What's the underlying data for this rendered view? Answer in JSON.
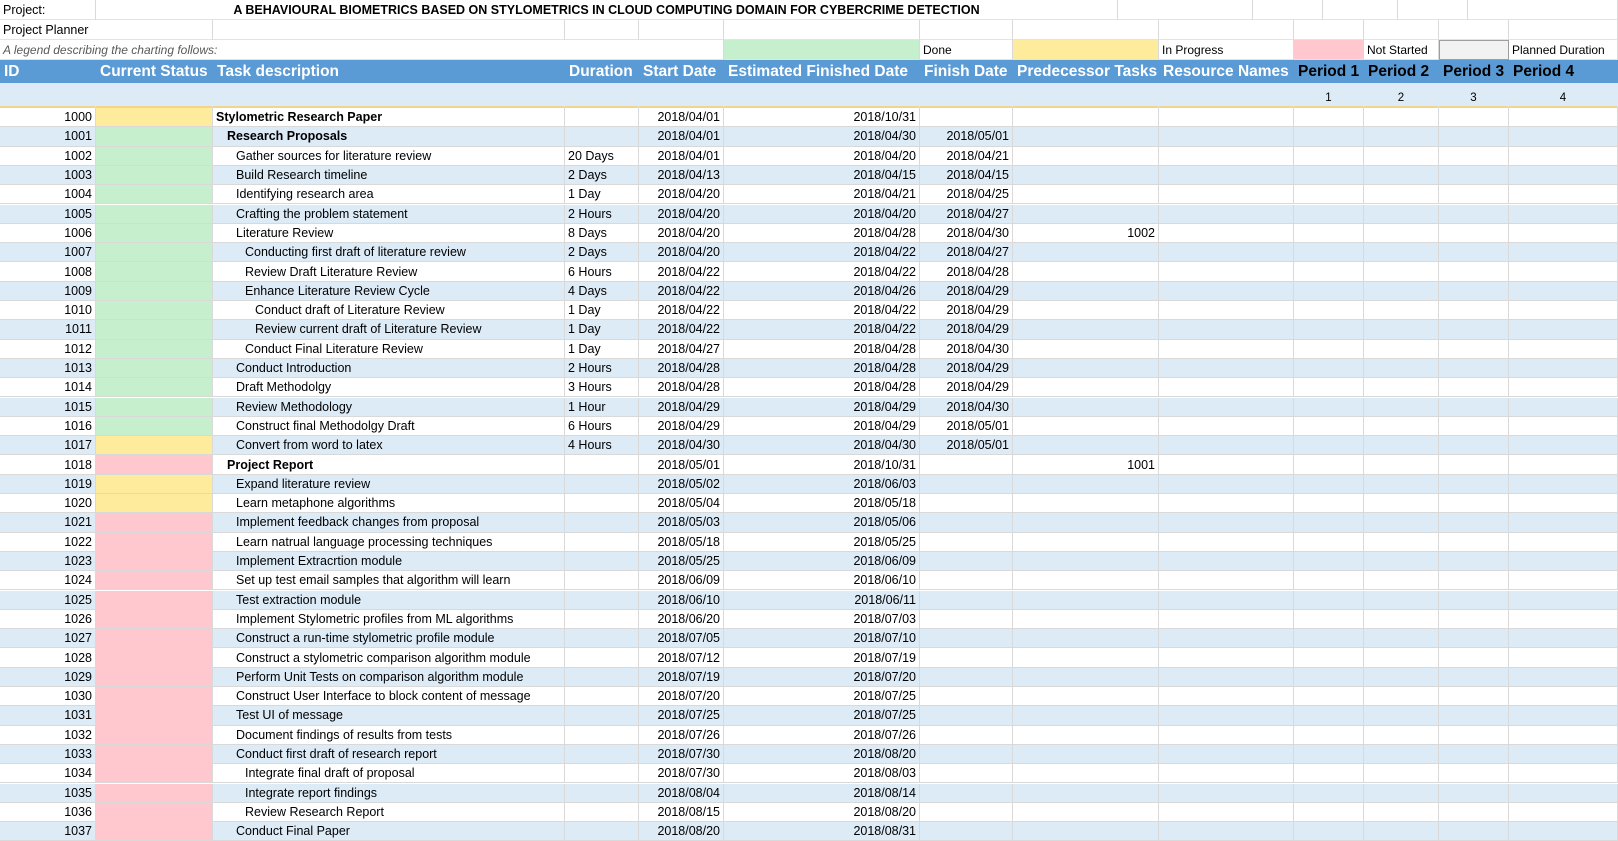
{
  "project_label": "Project:",
  "project_title": "A BEHAVIOURAL BIOMETRICS BASED ON STYLOMETRICS IN CLOUD COMPUTING DOMAIN FOR CYBERCRIME DETECTION",
  "planner_label": "Project Planner",
  "legend": {
    "text": "A legend describing the charting follows:",
    "done": "Done",
    "in_progress": "In Progress",
    "not_started": "Not Started",
    "planned": "Planned Duration"
  },
  "headers": {
    "id": "ID",
    "status": "Current Status",
    "task": "Task description",
    "duration": "Duration",
    "start": "Start Date",
    "est_finish": "Estimated Finished Date",
    "finish": "Finish Date",
    "predecessor": "Predecessor Tasks",
    "resource": "Resource Names",
    "p1": "Period 1",
    "p2": "Period 2",
    "p3": "Period 3",
    "p4": "Period 4"
  },
  "period_numbers": [
    "1",
    "2",
    "3",
    "4"
  ],
  "status_colors": {
    "done": "#c6efce",
    "in_progress": "#ffeb9c",
    "not_started": "#ffc7ce"
  },
  "rows": [
    {
      "id": "1000",
      "status": "in_progress",
      "level": 0,
      "task": "Stylometric Research Paper",
      "duration": "",
      "start": "2018/04/01",
      "est": "2018/10/31",
      "finish": "",
      "pred": ""
    },
    {
      "id": "1001",
      "status": "done",
      "level": 1,
      "task": "Research Proposals",
      "duration": "",
      "start": "2018/04/01",
      "est": "2018/04/30",
      "finish": "2018/05/01",
      "pred": ""
    },
    {
      "id": "1002",
      "status": "done",
      "level": 2,
      "task": "Gather sources for literature review",
      "duration": "20 Days",
      "start": "2018/04/01",
      "est": "2018/04/20",
      "finish": "2018/04/21",
      "pred": ""
    },
    {
      "id": "1003",
      "status": "done",
      "level": 2,
      "task": "Build Research timeline",
      "duration": "2 Days",
      "start": "2018/04/13",
      "est": "2018/04/15",
      "finish": "2018/04/15",
      "pred": ""
    },
    {
      "id": "1004",
      "status": "done",
      "level": 2,
      "task": "Identifying research area",
      "duration": "1 Day",
      "start": "2018/04/20",
      "est": "2018/04/21",
      "finish": "2018/04/25",
      "pred": ""
    },
    {
      "id": "1005",
      "status": "done",
      "level": 2,
      "task": "Crafting the problem statement",
      "duration": "2 Hours",
      "start": "2018/04/20",
      "est": "2018/04/20",
      "finish": "2018/04/27",
      "pred": ""
    },
    {
      "id": "1006",
      "status": "done",
      "level": 2,
      "task": "Literature Review",
      "duration": "8 Days",
      "start": "2018/04/20",
      "est": "2018/04/28",
      "finish": "2018/04/30",
      "pred": "1002"
    },
    {
      "id": "1007",
      "status": "done",
      "level": 3,
      "task": "Conducting first draft of literature review",
      "duration": "2 Days",
      "start": "2018/04/20",
      "est": "2018/04/22",
      "finish": "2018/04/27",
      "pred": ""
    },
    {
      "id": "1008",
      "status": "done",
      "level": 3,
      "task": "Review Draft Literature Review",
      "duration": "6 Hours",
      "start": "2018/04/22",
      "est": "2018/04/22",
      "finish": "2018/04/28",
      "pred": ""
    },
    {
      "id": "1009",
      "status": "done",
      "level": 3,
      "task": "Enhance Literature Review Cycle",
      "duration": "4 Days",
      "start": "2018/04/22",
      "est": "2018/04/26",
      "finish": "2018/04/29",
      "pred": ""
    },
    {
      "id": "1010",
      "status": "done",
      "level": 4,
      "task": "Conduct draft of Literature Review",
      "duration": "1 Day",
      "start": "2018/04/22",
      "est": "2018/04/22",
      "finish": "2018/04/29",
      "pred": ""
    },
    {
      "id": "1011",
      "status": "done",
      "level": 4,
      "task": "Review current draft of Literature Review",
      "duration": "1 Day",
      "start": "2018/04/22",
      "est": "2018/04/22",
      "finish": "2018/04/29",
      "pred": ""
    },
    {
      "id": "1012",
      "status": "done",
      "level": 3,
      "task": "Conduct Final Literature Review",
      "duration": "1 Day",
      "start": "2018/04/27",
      "est": "2018/04/28",
      "finish": "2018/04/30",
      "pred": ""
    },
    {
      "id": "1013",
      "status": "done",
      "level": 2,
      "task": "Conduct Introduction",
      "duration": "2 Hours",
      "start": "2018/04/28",
      "est": "2018/04/28",
      "finish": "2018/04/29",
      "pred": ""
    },
    {
      "id": "1014",
      "status": "done",
      "level": 2,
      "task": "Draft Methodolgy",
      "duration": "3 Hours",
      "start": "2018/04/28",
      "est": "2018/04/28",
      "finish": "2018/04/29",
      "pred": ""
    },
    {
      "id": "1015",
      "status": "done",
      "level": 2,
      "task": "Review Methodology",
      "duration": "1 Hour",
      "start": "2018/04/29",
      "est": "2018/04/29",
      "finish": "2018/04/30",
      "pred": ""
    },
    {
      "id": "1016",
      "status": "done",
      "level": 2,
      "task": "Construct final Methodolgy Draft",
      "duration": "6 Hours",
      "start": "2018/04/29",
      "est": "2018/04/29",
      "finish": "2018/05/01",
      "pred": ""
    },
    {
      "id": "1017",
      "status": "in_progress",
      "level": 2,
      "task": "Convert from word to latex",
      "duration": "4 Hours",
      "start": "2018/04/30",
      "est": "2018/04/30",
      "finish": "2018/05/01",
      "pred": ""
    },
    {
      "id": "1018",
      "status": "not_started",
      "level": 1,
      "task": "Project Report",
      "duration": "",
      "start": "2018/05/01",
      "est": "2018/10/31",
      "finish": "",
      "pred": "1001"
    },
    {
      "id": "1019",
      "status": "in_progress",
      "level": 2,
      "task": "Expand literature review",
      "duration": "",
      "start": "2018/05/02",
      "est": "2018/06/03",
      "finish": "",
      "pred": ""
    },
    {
      "id": "1020",
      "status": "in_progress",
      "level": 2,
      "task": "Learn metaphone algorithms",
      "duration": "",
      "start": "2018/05/04",
      "est": "2018/05/18",
      "finish": "",
      "pred": ""
    },
    {
      "id": "1021",
      "status": "not_started",
      "level": 2,
      "task": "Implement feedback changes from proposal",
      "duration": "",
      "start": "2018/05/03",
      "est": "2018/05/06",
      "finish": "",
      "pred": ""
    },
    {
      "id": "1022",
      "status": "not_started",
      "level": 2,
      "task": "Learn natrual language processing techniques",
      "duration": "",
      "start": "2018/05/18",
      "est": "2018/05/25",
      "finish": "",
      "pred": ""
    },
    {
      "id": "1023",
      "status": "not_started",
      "level": 2,
      "task": "Implement Extracrtion module",
      "duration": "",
      "start": "2018/05/25",
      "est": "2018/06/09",
      "finish": "",
      "pred": ""
    },
    {
      "id": "1024",
      "status": "not_started",
      "level": 2,
      "task": "Set up test email samples that algorithm will learn",
      "duration": "",
      "start": "2018/06/09",
      "est": "2018/06/10",
      "finish": "",
      "pred": ""
    },
    {
      "id": "1025",
      "status": "not_started",
      "level": 2,
      "task": "Test extraction module",
      "duration": "",
      "start": "2018/06/10",
      "est": "2018/06/11",
      "finish": "",
      "pred": ""
    },
    {
      "id": "1026",
      "status": "not_started",
      "level": 2,
      "task": "Implement Stylometric profiles from ML algorithms",
      "duration": "",
      "start": "2018/06/20",
      "est": "2018/07/03",
      "finish": "",
      "pred": ""
    },
    {
      "id": "1027",
      "status": "not_started",
      "level": 2,
      "task": "Construct a run-time stylometric profile module",
      "duration": "",
      "start": "2018/07/05",
      "est": "2018/07/10",
      "finish": "",
      "pred": ""
    },
    {
      "id": "1028",
      "status": "not_started",
      "level": 2,
      "task": "Construct a stylometric comparison algorithm module",
      "duration": "",
      "start": "2018/07/12",
      "est": "2018/07/19",
      "finish": "",
      "pred": ""
    },
    {
      "id": "1029",
      "status": "not_started",
      "level": 2,
      "task": "Perform Unit Tests on comparison algorithm module",
      "duration": "",
      "start": "2018/07/19",
      "est": "2018/07/20",
      "finish": "",
      "pred": ""
    },
    {
      "id": "1030",
      "status": "not_started",
      "level": 2,
      "task": "Construct User Interface to block content of message",
      "duration": "",
      "start": "2018/07/20",
      "est": "2018/07/25",
      "finish": "",
      "pred": ""
    },
    {
      "id": "1031",
      "status": "not_started",
      "level": 2,
      "task": "Test UI of message",
      "duration": "",
      "start": "2018/07/25",
      "est": "2018/07/25",
      "finish": "",
      "pred": ""
    },
    {
      "id": "1032",
      "status": "not_started",
      "level": 2,
      "task": "Document findings of results from tests",
      "duration": "",
      "start": "2018/07/26",
      "est": "2018/07/26",
      "finish": "",
      "pred": ""
    },
    {
      "id": "1033",
      "status": "not_started",
      "level": 2,
      "task": "Conduct first draft of research report",
      "duration": "",
      "start": "2018/07/30",
      "est": "2018/08/20",
      "finish": "",
      "pred": ""
    },
    {
      "id": "1034",
      "status": "not_started",
      "level": 3,
      "task": "Integrate final draft of proposal",
      "duration": "",
      "start": "2018/07/30",
      "est": "2018/08/03",
      "finish": "",
      "pred": ""
    },
    {
      "id": "1035",
      "status": "not_started",
      "level": 3,
      "task": "Integrate report findings",
      "duration": "",
      "start": "2018/08/04",
      "est": "2018/08/14",
      "finish": "",
      "pred": ""
    },
    {
      "id": "1036",
      "status": "not_started",
      "level": 3,
      "task": "Review Research Report",
      "duration": "",
      "start": "2018/08/15",
      "est": "2018/08/20",
      "finish": "",
      "pred": ""
    },
    {
      "id": "1037",
      "status": "not_started",
      "level": 2,
      "task": "Conduct Final Paper",
      "duration": "",
      "start": "2018/08/20",
      "est": "2018/08/31",
      "finish": "",
      "pred": ""
    }
  ]
}
